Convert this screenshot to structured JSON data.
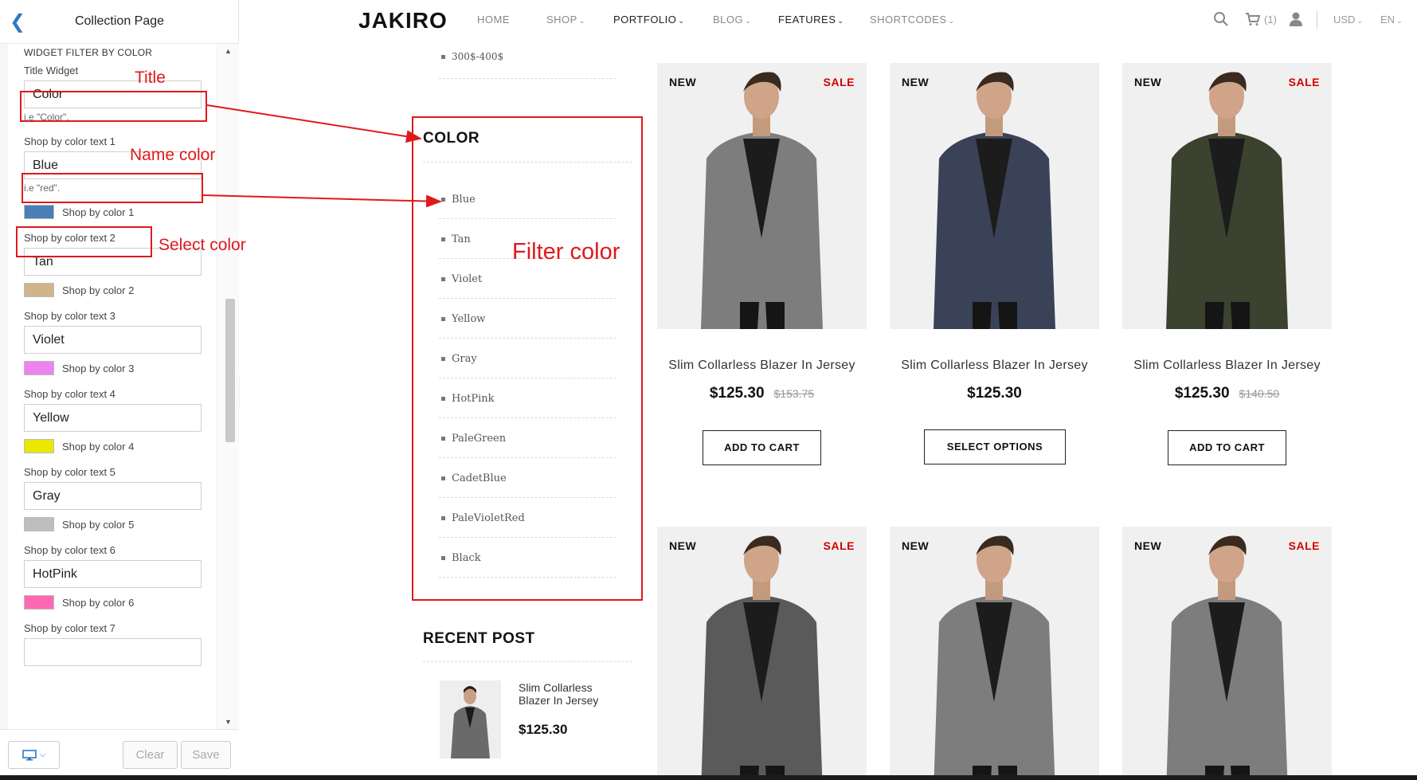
{
  "editor": {
    "title": "Collection Page",
    "section_label": "WIDGET FILTER BY COLOR",
    "title_widget_label": "Title Widget",
    "title_widget_value": "Color",
    "title_widget_hint": "i.e \"Color\".",
    "colors": [
      {
        "text_label": "Shop by color text 1",
        "text_value": "Blue",
        "hint": "i.e \"red\".",
        "swatch_label": "Shop by color 1",
        "swatch_color": "#4a7fb5"
      },
      {
        "text_label": "Shop by color text 2",
        "text_value": "Tan",
        "swatch_label": "Shop by color 2",
        "swatch_color": "#d2b48c"
      },
      {
        "text_label": "Shop by color text 3",
        "text_value": "Violet",
        "swatch_label": "Shop by color 3",
        "swatch_color": "#ee82ee"
      },
      {
        "text_label": "Shop by color text 4",
        "text_value": "Yellow",
        "swatch_label": "Shop by color 4",
        "swatch_color": "#e8e800"
      },
      {
        "text_label": "Shop by color text 5",
        "text_value": "Gray",
        "swatch_label": "Shop by color 5",
        "swatch_color": "#bebebe"
      },
      {
        "text_label": "Shop by color text 6",
        "text_value": "HotPink",
        "swatch_label": "Shop by color 6",
        "swatch_color": "#ff69b4"
      },
      {
        "text_label": "Shop by color text 7"
      }
    ],
    "clear_label": "Clear",
    "save_label": "Save",
    "back_icon": "chevron-left-icon",
    "device_icon": "desktop-icon"
  },
  "nav": {
    "logo": "JAKIRO",
    "items": [
      "HOME",
      "SHOP",
      "PORTFOLIO",
      "BLOG",
      "FEATURES",
      "SHORTCODES"
    ],
    "cart_count": "(1)",
    "currency": "USD",
    "language": "EN"
  },
  "sidebar": {
    "price_item": "300$-400$",
    "color_title": "COLOR",
    "color_items": [
      "Blue",
      "Tan",
      "Violet",
      "Yellow",
      "Gray",
      "HotPink",
      "PaleGreen",
      "CadetBlue",
      "PaleVioletRed",
      "Black"
    ],
    "recent_title": "RECENT POST",
    "recent_name": "Slim Collarless Blazer In Jersey",
    "recent_price": "$125.30"
  },
  "products": [
    {
      "name": "Slim Collarless Blazer In Jersey",
      "price": "$125.30",
      "old_price": "$153.75",
      "button": "ADD TO CART",
      "new": "NEW",
      "sale": "SALE",
      "coat": "#7d7d7d"
    },
    {
      "name": "Slim Collarless Blazer In Jersey",
      "price": "$125.30",
      "old_price": "",
      "button": "SELECT OPTIONS",
      "new": "NEW",
      "sale": "",
      "coat": "#3a4258"
    },
    {
      "name": "Slim Collarless Blazer In Jersey",
      "price": "$125.30",
      "old_price": "$140.50",
      "button": "ADD TO CART",
      "new": "NEW",
      "sale": "SALE",
      "coat": "#3b4230"
    },
    {
      "new": "NEW",
      "sale": "SALE",
      "coat": "#5a5a5a"
    },
    {
      "new": "NEW",
      "sale": "",
      "coat": "#7d7d7d"
    },
    {
      "new": "NEW",
      "sale": "SALE",
      "coat": "#7d7d7d"
    }
  ],
  "annotations": {
    "title": "Title",
    "name_color": "Name color",
    "select_color": "Select color",
    "filter_color": "Filter color",
    "color": "#e0191d"
  }
}
